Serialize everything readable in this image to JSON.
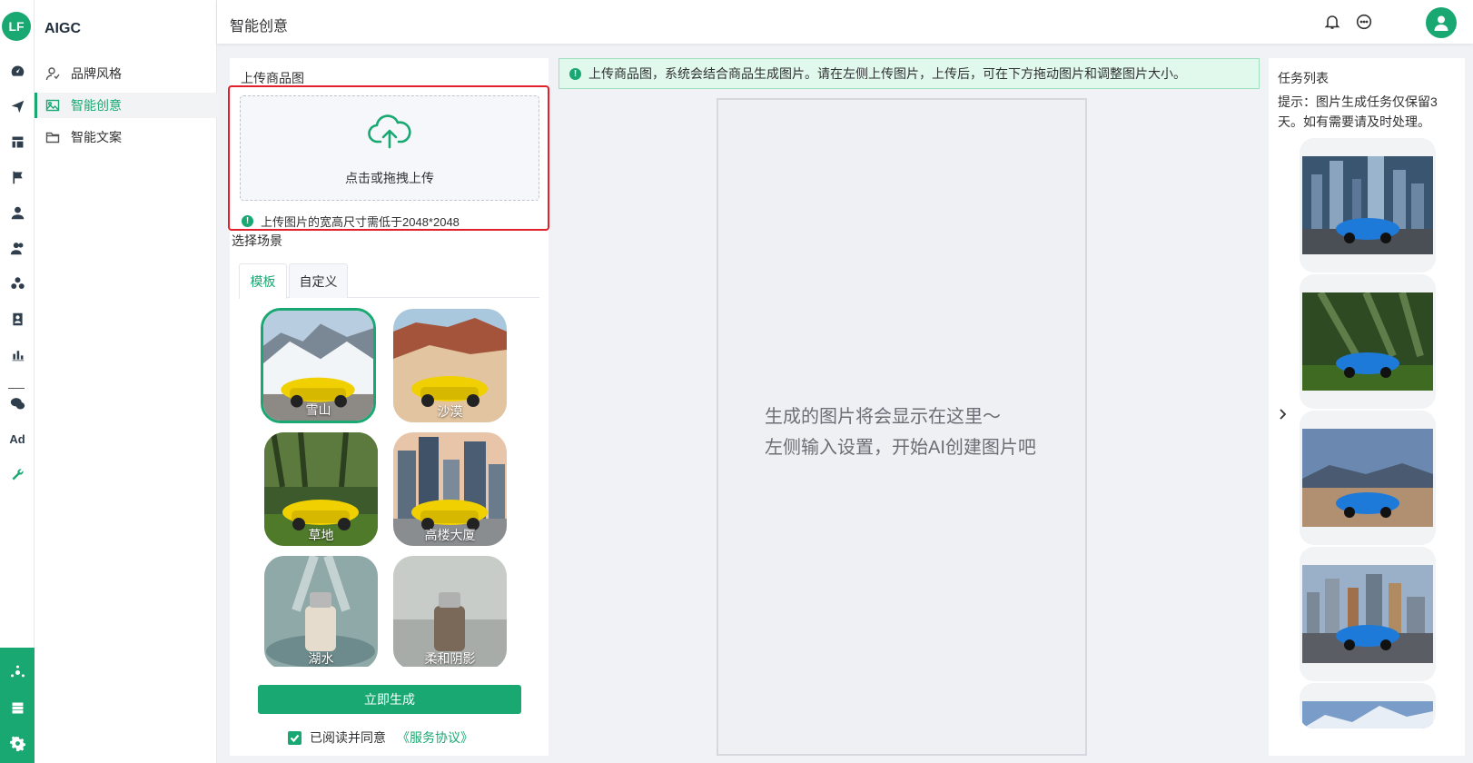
{
  "brand": {
    "logo_text": "LF",
    "app_name": "AIGC",
    "accent": "#1aa872"
  },
  "rail_icons": [
    "dashboard-icon",
    "send-icon",
    "layout-icon",
    "flag-icon",
    "user-icon",
    "users-icon",
    "group-icon",
    "contacts-icon",
    "chart-icon",
    "wechat-icon",
    "ad-icon",
    "wrench-icon"
  ],
  "rail_bottom_icons": [
    "settings-network-icon",
    "server-icon",
    "gear-icon"
  ],
  "sidebar": {
    "items": [
      {
        "label": "品牌风格",
        "icon": "brand-style-icon",
        "active": false
      },
      {
        "label": "智能创意",
        "icon": "image-icon",
        "active": true
      },
      {
        "label": "智能文案",
        "icon": "folder-icon",
        "active": false
      }
    ]
  },
  "header": {
    "title": "智能创意",
    "icons": [
      "bell-icon",
      "chat-icon",
      "avatar-icon"
    ]
  },
  "upload": {
    "section_title": "上传商品图",
    "drop_text": "点击或拖拽上传",
    "hint": "上传图片的宽高尺寸需低于2048*2048"
  },
  "scene": {
    "section_title": "选择场景",
    "tabs": [
      {
        "label": "模板",
        "active": true
      },
      {
        "label": "自定义",
        "active": false
      }
    ],
    "templates": [
      {
        "label": "雪山",
        "selected": true
      },
      {
        "label": "沙漠",
        "selected": false
      },
      {
        "label": "草地",
        "selected": false
      },
      {
        "label": "高楼大厦",
        "selected": false
      },
      {
        "label": "湖水",
        "selected": false
      },
      {
        "label": "柔和阴影",
        "selected": false
      }
    ]
  },
  "actions": {
    "generate_label": "立即生成",
    "agree_text": "已阅读并同意",
    "agree_link": "《服务协议》",
    "agree_checked": true
  },
  "banner": {
    "text": "上传商品图，系统会结合商品生成图片。请在左侧上传图片，上传后，可在下方拖动图片和调整图片大小。"
  },
  "canvas": {
    "placeholder_line1": "生成的图片将会显示在这里～",
    "placeholder_line2": "左侧输入设置，开始AI创建图片吧"
  },
  "tasks": {
    "title": "任务列表",
    "tip": "提示：图片生成任务仅保留3天。如有需要请及时处理。",
    "items": [
      "city-night",
      "forest",
      "desert-sky",
      "city-day",
      "mountain"
    ]
  }
}
